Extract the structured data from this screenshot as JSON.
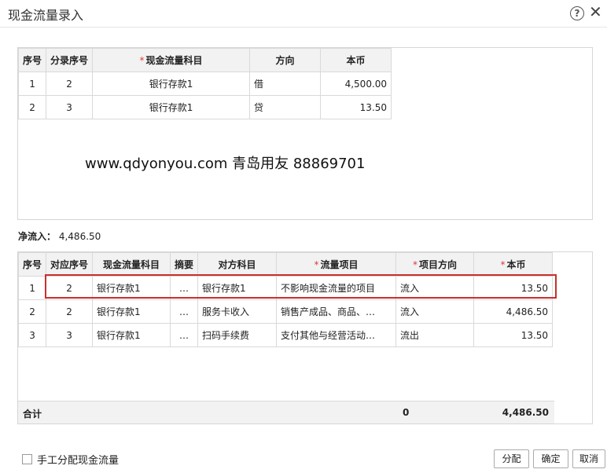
{
  "window": {
    "title": "现金流量录入",
    "help_icon": "?",
    "close_icon": "✕"
  },
  "top_table": {
    "headers": {
      "seq": "序号",
      "entry_seq": "分录序号",
      "subject": "现金流量科目",
      "direction": "方向",
      "amount": "本币"
    },
    "rows": [
      {
        "seq": "1",
        "entry_seq": "2",
        "subject": "银行存款1",
        "direction": "借",
        "amount": "4,500.00"
      },
      {
        "seq": "2",
        "entry_seq": "3",
        "subject": "银行存款1",
        "direction": "贷",
        "amount": "13.50"
      }
    ]
  },
  "watermark": "www.qdyonyou.com  青岛用友 88869701",
  "net_flow": {
    "label": "净流入：",
    "value": "4,486.50"
  },
  "bottom_table": {
    "headers": {
      "seq": "序号",
      "ref_seq": "对应序号",
      "subject": "现金流量科目",
      "summary": "摘要",
      "counter": "对方科目",
      "item": "流量项目",
      "item_dir": "项目方向",
      "amount": "本币"
    },
    "rows": [
      {
        "seq": "1",
        "ref_seq": "2",
        "subject": "银行存款1",
        "summary": "…",
        "counter": "银行存款1",
        "item": "不影响现金流量的项目",
        "item_dir": "流入",
        "amount": "13.50"
      },
      {
        "seq": "2",
        "ref_seq": "2",
        "subject": "银行存款1",
        "summary": "…",
        "counter": "服务卡收入",
        "item": "销售产成品、商品、…",
        "item_dir": "流入",
        "amount": "4,486.50"
      },
      {
        "seq": "3",
        "ref_seq": "3",
        "subject": "银行存款1",
        "summary": "…",
        "counter": "扫码手续费",
        "item": "支付其他与经营活动…",
        "item_dir": "流出",
        "amount": "13.50"
      }
    ],
    "total": {
      "label": "合计",
      "direction": "0",
      "amount": "4,486.50"
    }
  },
  "footer": {
    "manual_alloc_label": "手工分配现金流量",
    "buttons": {
      "allocate": "分配",
      "ok": "确定",
      "cancel": "取消"
    }
  },
  "colors": {
    "highlight_border": "#c9302c",
    "required_star": "#e03b3b",
    "header_bg": "#f2f2f2"
  }
}
